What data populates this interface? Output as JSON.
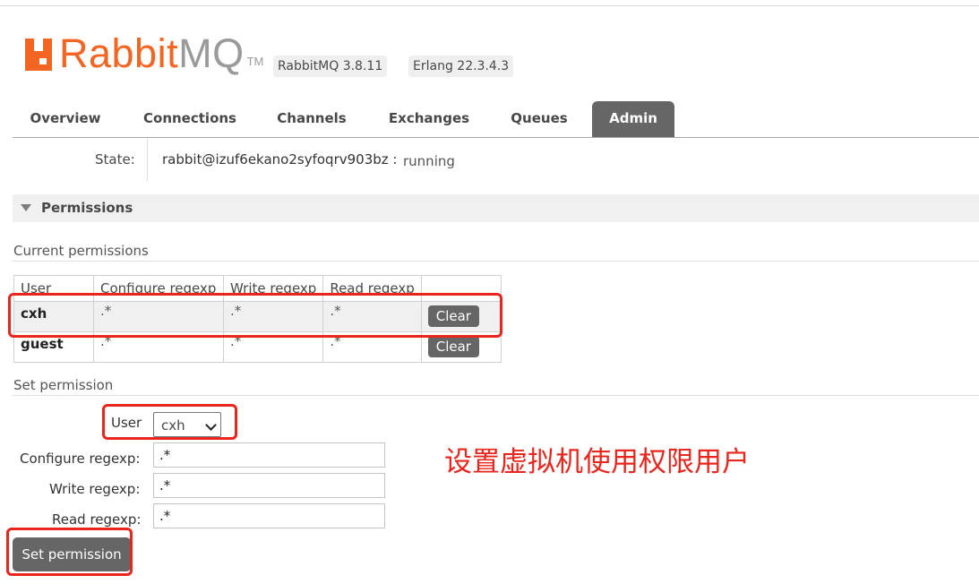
{
  "header": {
    "logo_rabbit": "Rabbit",
    "logo_mq": "MQ",
    "logo_tm": "TM",
    "rabbitmq_version": "RabbitMQ 3.8.11",
    "erlang_version": "Erlang 22.3.4.3"
  },
  "tabs": [
    {
      "label": "Overview",
      "active": false
    },
    {
      "label": "Connections",
      "active": false
    },
    {
      "label": "Channels",
      "active": false
    },
    {
      "label": "Exchanges",
      "active": false
    },
    {
      "label": "Queues",
      "active": false
    },
    {
      "label": "Admin",
      "active": true
    }
  ],
  "state": {
    "label": "State:",
    "node": "rabbit@izuf6ekano2syfoqrv903bz :",
    "status": "running"
  },
  "permissions": {
    "section_title": "Permissions",
    "current_title": "Current permissions",
    "columns": [
      "User",
      "Configure regexp",
      "Write regexp",
      "Read regexp"
    ],
    "rows": [
      {
        "user": "cxh",
        "configure": ".*",
        "write": ".*",
        "read": ".*",
        "action": "Clear"
      },
      {
        "user": "guest",
        "configure": ".*",
        "write": ".*",
        "read": ".*",
        "action": "Clear"
      }
    ]
  },
  "set_permission": {
    "title": "Set permission",
    "user_label": "User",
    "user_selected": "cxh",
    "configure_label": "Configure regexp:",
    "configure_value": ".*",
    "write_label": "Write regexp:",
    "write_value": ".*",
    "read_label": "Read regexp:",
    "read_value": ".*",
    "submit_label": "Set permission"
  },
  "annotation": {
    "text": "设置虚拟机使用权限用户",
    "color": "#e8261d"
  },
  "colors": {
    "brand_orange": "#f26522",
    "tab_active": "#666666",
    "button": "#666666"
  }
}
